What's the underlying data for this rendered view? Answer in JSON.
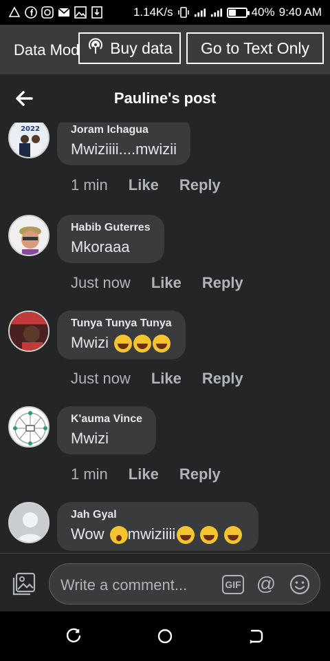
{
  "status_bar": {
    "network_speed": "1.14K/s",
    "battery_percent": "40%",
    "battery_level": 0.4,
    "time": "9:40 AM",
    "icons": [
      "warning-icon",
      "facebook-icon",
      "instagram-icon",
      "mail-icon",
      "image-icon",
      "download-icon",
      "vibrate-icon",
      "signal-icon",
      "signal-icon",
      "battery-icon"
    ]
  },
  "data_bar": {
    "label": "Data Mode",
    "buy_data": "Buy data",
    "text_only": "Go to Text Only"
  },
  "header": {
    "title": "Pauline's post",
    "back_icon": "arrow-left-icon"
  },
  "comments": [
    {
      "author": "Joram Ichagua",
      "text": "Mwiziiii....mwizii",
      "time": "1 min",
      "like": "Like",
      "reply": "Reply"
    },
    {
      "author": "Habib Guterres",
      "text": "Mkoraaa",
      "time": "Just now",
      "like": "Like",
      "reply": "Reply"
    },
    {
      "author": "Tunya Tunya Tunya",
      "text": "Mwizi",
      "emojis": [
        "rofl",
        "rofl",
        "rofl"
      ],
      "time": "Just now",
      "like": "Like",
      "reply": "Reply"
    },
    {
      "author": "K'auma Vince",
      "text": "Mwizi",
      "time": "1 min",
      "like": "Like",
      "reply": "Reply"
    },
    {
      "author": "Jah Gyal",
      "text_before": "Wow",
      "text_after": "mwiziiii",
      "emojis": [
        "wow",
        "rofl",
        "rofl",
        "rofl"
      ]
    }
  ],
  "compose": {
    "placeholder": "Write a comment...",
    "gif_label": "GIF",
    "at_label": "@",
    "icons": [
      "photo-icon",
      "gif-icon",
      "at-icon",
      "smile-icon"
    ]
  },
  "nav": {
    "icons": [
      "recent-apps-icon",
      "home-icon",
      "back-icon"
    ]
  }
}
